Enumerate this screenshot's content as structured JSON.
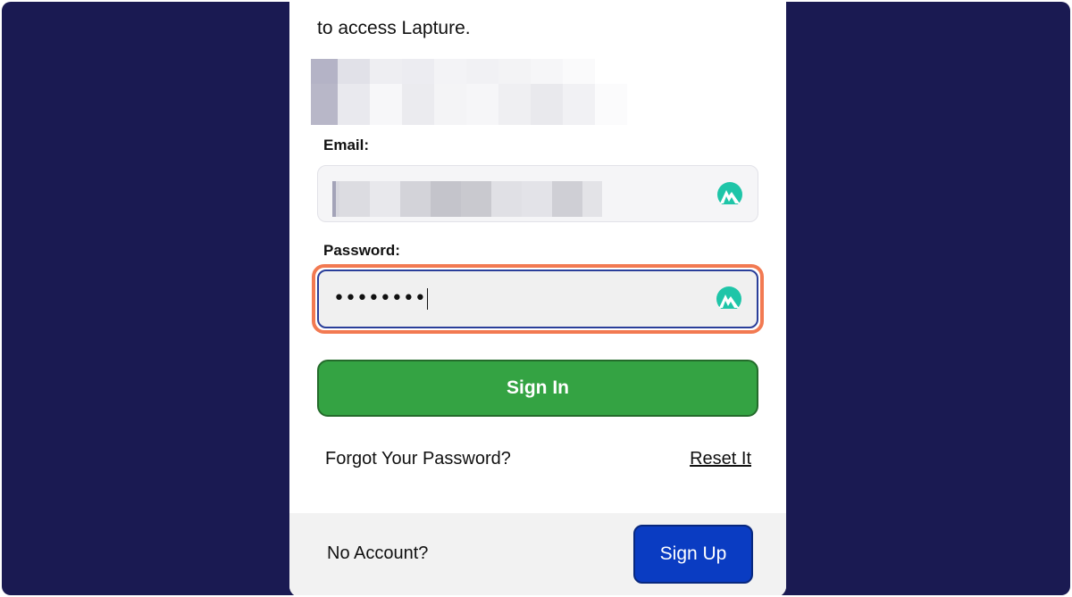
{
  "page": {
    "subtitle": "to access Lapture."
  },
  "form": {
    "email_label": "Email:",
    "password_label": "Password:",
    "password_value": "••••••••",
    "signin_label": "Sign In",
    "forgot_text": "Forgot Your Password?",
    "reset_label": "Reset It"
  },
  "footer": {
    "no_account_text": "No Account?",
    "signup_label": "Sign Up"
  },
  "icons": {
    "password_manager": "nordpass-icon"
  },
  "colors": {
    "background": "#1a1a52",
    "signin": "#34a343",
    "signup": "#0a3cc2",
    "focus_ring": "#f27a52",
    "nord_icon": "#1fc5a8"
  }
}
